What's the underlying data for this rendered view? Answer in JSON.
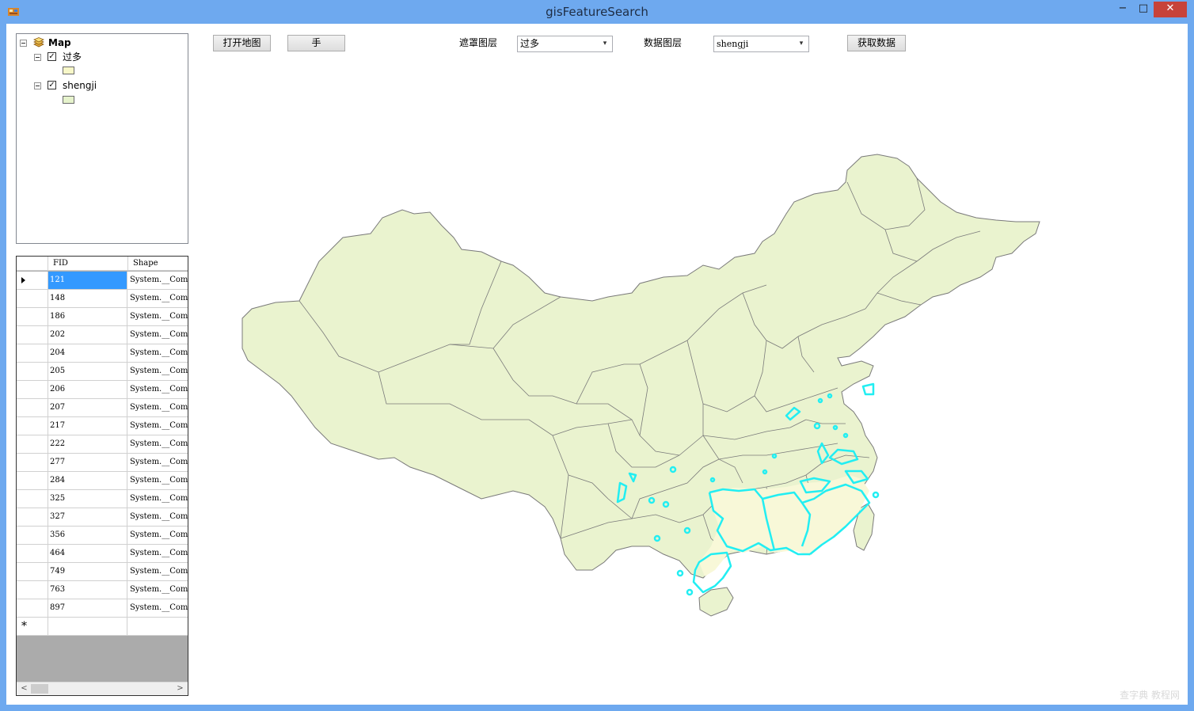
{
  "window": {
    "title": "gisFeatureSearch",
    "minimize_glyph": "−",
    "maximize_glyph": "□",
    "close_glyph": "✕"
  },
  "toc": {
    "root_label": "Map",
    "layers": [
      {
        "name": "过多",
        "checked": true
      },
      {
        "name": "shengji",
        "checked": true
      }
    ],
    "check_glyph": "✓"
  },
  "toolbar": {
    "open_map": "打开地图",
    "pan_tool": "手",
    "mask_layer_label": "遮罩图层",
    "mask_layer_value": "过多",
    "data_layer_label": "数据图层",
    "data_layer_value": "shengji",
    "get_data": "获取数据"
  },
  "grid": {
    "columns": [
      "FID",
      "Shape"
    ],
    "rows": [
      {
        "fid": "121",
        "shape": "System.__ComObject"
      },
      {
        "fid": "148",
        "shape": "System.__ComObject"
      },
      {
        "fid": "186",
        "shape": "System.__ComObject"
      },
      {
        "fid": "202",
        "shape": "System.__ComObject"
      },
      {
        "fid": "204",
        "shape": "System.__ComObject"
      },
      {
        "fid": "205",
        "shape": "System.__ComObject"
      },
      {
        "fid": "206",
        "shape": "System.__ComObject"
      },
      {
        "fid": "207",
        "shape": "System.__ComObject"
      },
      {
        "fid": "217",
        "shape": "System.__ComObject"
      },
      {
        "fid": "222",
        "shape": "System.__ComObject"
      },
      {
        "fid": "277",
        "shape": "System.__ComObject"
      },
      {
        "fid": "284",
        "shape": "System.__ComObject"
      },
      {
        "fid": "325",
        "shape": "System.__ComObject"
      },
      {
        "fid": "327",
        "shape": "System.__ComObject"
      },
      {
        "fid": "356",
        "shape": "System.__ComObject"
      },
      {
        "fid": "464",
        "shape": "System.__ComObject"
      },
      {
        "fid": "749",
        "shape": "System.__ComObject"
      },
      {
        "fid": "763",
        "shape": "System.__ComObject"
      },
      {
        "fid": "897",
        "shape": "System.__ComObject"
      }
    ],
    "selected_index": 0,
    "new_row_glyph": "*",
    "scroll_left": "<",
    "scroll_right": ">"
  },
  "map": {
    "fill_color": "#eaf3cf",
    "highlight_fill": "#f8f8d8",
    "border_color": "#7a7a7a",
    "highlight_color": "#22eef2"
  },
  "watermark": "查字典 教程网"
}
